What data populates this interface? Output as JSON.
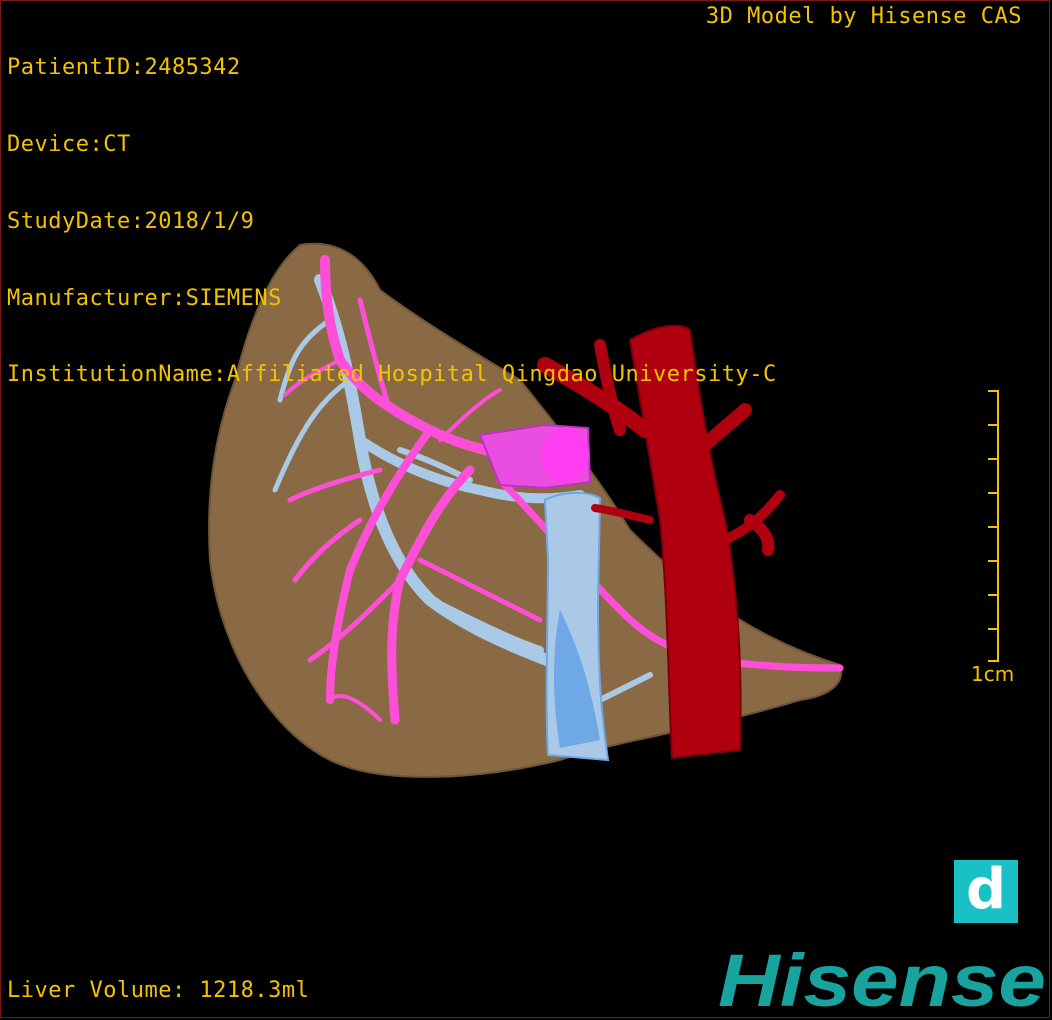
{
  "info": {
    "patient_id": "PatientID:2485342",
    "device": "Device:CT",
    "study_date": "StudyDate:2018/1/9",
    "manufacturer": "Manufacturer:SIEMENS",
    "institution": "InstitutionName:Affiliated Hospital Qingdao University-C"
  },
  "model_label": "3D Model by Hisense CAS",
  "volume_label": "Liver Volume: 1218.3ml",
  "scale": {
    "label": "1cm"
  },
  "d_button": {
    "label": "d"
  },
  "logo": {
    "text": "Hisense"
  },
  "colors": {
    "overlay_text": "#f2c300",
    "liver": "#8a6a45",
    "portal_vein": "#ff4fd8",
    "hepatic_vein": "#a9c9e6",
    "ivc": "#6fa8e6",
    "artery": "#b00010",
    "brand": "#19a39e"
  }
}
